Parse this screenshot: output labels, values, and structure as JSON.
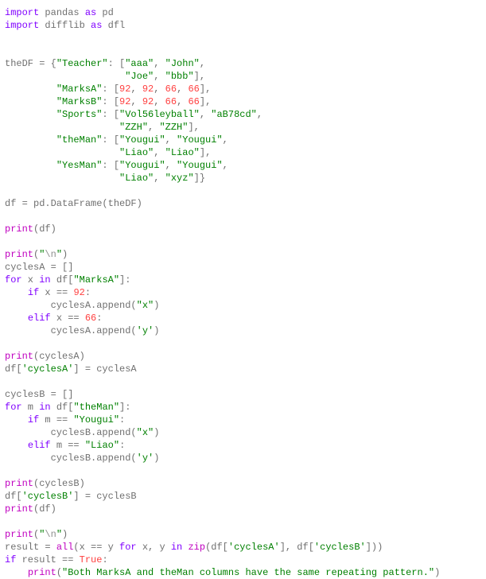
{
  "lines": [
    [
      {
        "cls": "kw",
        "t": "import"
      },
      {
        "cls": "",
        "t": " pandas "
      },
      {
        "cls": "kw",
        "t": "as"
      },
      {
        "cls": "",
        "t": " pd"
      }
    ],
    [
      {
        "cls": "kw",
        "t": "import"
      },
      {
        "cls": "",
        "t": " difflib "
      },
      {
        "cls": "kw",
        "t": "as"
      },
      {
        "cls": "",
        "t": " dfl"
      }
    ],
    [],
    [],
    [
      {
        "cls": "",
        "t": "theDF = {"
      },
      {
        "cls": "str",
        "t": "\"Teacher\""
      },
      {
        "cls": "",
        "t": ": ["
      },
      {
        "cls": "str",
        "t": "\"aaa\""
      },
      {
        "cls": "",
        "t": ", "
      },
      {
        "cls": "str",
        "t": "\"John\""
      },
      {
        "cls": "",
        "t": ","
      }
    ],
    [
      {
        "cls": "",
        "t": "                     "
      },
      {
        "cls": "str",
        "t": "\"Joe\""
      },
      {
        "cls": "",
        "t": ", "
      },
      {
        "cls": "str",
        "t": "\"bbb\""
      },
      {
        "cls": "",
        "t": "],"
      }
    ],
    [
      {
        "cls": "",
        "t": "         "
      },
      {
        "cls": "str",
        "t": "\"MarksA\""
      },
      {
        "cls": "",
        "t": ": ["
      },
      {
        "cls": "num",
        "t": "92"
      },
      {
        "cls": "",
        "t": ", "
      },
      {
        "cls": "num",
        "t": "92"
      },
      {
        "cls": "",
        "t": ", "
      },
      {
        "cls": "num",
        "t": "66"
      },
      {
        "cls": "",
        "t": ", "
      },
      {
        "cls": "num",
        "t": "66"
      },
      {
        "cls": "",
        "t": "],"
      }
    ],
    [
      {
        "cls": "",
        "t": "         "
      },
      {
        "cls": "str",
        "t": "\"MarksB\""
      },
      {
        "cls": "",
        "t": ": ["
      },
      {
        "cls": "num",
        "t": "92"
      },
      {
        "cls": "",
        "t": ", "
      },
      {
        "cls": "num",
        "t": "92"
      },
      {
        "cls": "",
        "t": ", "
      },
      {
        "cls": "num",
        "t": "66"
      },
      {
        "cls": "",
        "t": ", "
      },
      {
        "cls": "num",
        "t": "66"
      },
      {
        "cls": "",
        "t": "],"
      }
    ],
    [
      {
        "cls": "",
        "t": "         "
      },
      {
        "cls": "str",
        "t": "\"Sports\""
      },
      {
        "cls": "",
        "t": ": ["
      },
      {
        "cls": "str",
        "t": "\"Vol56leyball\""
      },
      {
        "cls": "",
        "t": ", "
      },
      {
        "cls": "str",
        "t": "\"aB78cd\""
      },
      {
        "cls": "",
        "t": ","
      }
    ],
    [
      {
        "cls": "",
        "t": "                    "
      },
      {
        "cls": "str",
        "t": "\"ZZH\""
      },
      {
        "cls": "",
        "t": ", "
      },
      {
        "cls": "str",
        "t": "\"ZZH\""
      },
      {
        "cls": "",
        "t": "],"
      }
    ],
    [
      {
        "cls": "",
        "t": "         "
      },
      {
        "cls": "str",
        "t": "\"theMan\""
      },
      {
        "cls": "",
        "t": ": ["
      },
      {
        "cls": "str",
        "t": "\"Yougui\""
      },
      {
        "cls": "",
        "t": ", "
      },
      {
        "cls": "str",
        "t": "\"Yougui\""
      },
      {
        "cls": "",
        "t": ","
      }
    ],
    [
      {
        "cls": "",
        "t": "                    "
      },
      {
        "cls": "str",
        "t": "\"Liao\""
      },
      {
        "cls": "",
        "t": ", "
      },
      {
        "cls": "str",
        "t": "\"Liao\""
      },
      {
        "cls": "",
        "t": "],"
      }
    ],
    [
      {
        "cls": "",
        "t": "         "
      },
      {
        "cls": "str",
        "t": "\"YesMan\""
      },
      {
        "cls": "",
        "t": ": ["
      },
      {
        "cls": "str",
        "t": "\"Yougui\""
      },
      {
        "cls": "",
        "t": ", "
      },
      {
        "cls": "str",
        "t": "\"Yougui\""
      },
      {
        "cls": "",
        "t": ","
      }
    ],
    [
      {
        "cls": "",
        "t": "                    "
      },
      {
        "cls": "str",
        "t": "\"Liao\""
      },
      {
        "cls": "",
        "t": ", "
      },
      {
        "cls": "str",
        "t": "\"xyz\""
      },
      {
        "cls": "",
        "t": "]}"
      }
    ],
    [],
    [
      {
        "cls": "",
        "t": "df = pd.DataFrame(theDF)"
      }
    ],
    [],
    [
      {
        "cls": "fn",
        "t": "print"
      },
      {
        "cls": "",
        "t": "(df)"
      }
    ],
    [],
    [
      {
        "cls": "fn",
        "t": "print"
      },
      {
        "cls": "",
        "t": "("
      },
      {
        "cls": "str",
        "t": "\""
      },
      {
        "cls": "esc",
        "t": "\\n"
      },
      {
        "cls": "str",
        "t": "\""
      },
      {
        "cls": "",
        "t": ")"
      }
    ],
    [
      {
        "cls": "",
        "t": "cyclesA = []"
      }
    ],
    [
      {
        "cls": "kw",
        "t": "for"
      },
      {
        "cls": "",
        "t": " x "
      },
      {
        "cls": "kw",
        "t": "in"
      },
      {
        "cls": "",
        "t": " df["
      },
      {
        "cls": "str",
        "t": "\"MarksA\""
      },
      {
        "cls": "",
        "t": "]:"
      }
    ],
    [
      {
        "cls": "",
        "t": "    "
      },
      {
        "cls": "kw",
        "t": "if"
      },
      {
        "cls": "",
        "t": " x == "
      },
      {
        "cls": "num",
        "t": "92"
      },
      {
        "cls": "",
        "t": ":"
      }
    ],
    [
      {
        "cls": "",
        "t": "        cyclesA.append("
      },
      {
        "cls": "str",
        "t": "\"x\""
      },
      {
        "cls": "",
        "t": ")"
      }
    ],
    [
      {
        "cls": "",
        "t": "    "
      },
      {
        "cls": "kw",
        "t": "elif"
      },
      {
        "cls": "",
        "t": " x == "
      },
      {
        "cls": "num",
        "t": "66"
      },
      {
        "cls": "",
        "t": ":"
      }
    ],
    [
      {
        "cls": "",
        "t": "        cyclesA.append("
      },
      {
        "cls": "str",
        "t": "'y'"
      },
      {
        "cls": "",
        "t": ")"
      }
    ],
    [],
    [
      {
        "cls": "fn",
        "t": "print"
      },
      {
        "cls": "",
        "t": "(cyclesA)"
      }
    ],
    [
      {
        "cls": "",
        "t": "df["
      },
      {
        "cls": "str",
        "t": "'cyclesA'"
      },
      {
        "cls": "",
        "t": "] = cyclesA"
      }
    ],
    [],
    [
      {
        "cls": "",
        "t": "cyclesB = []"
      }
    ],
    [
      {
        "cls": "kw",
        "t": "for"
      },
      {
        "cls": "",
        "t": " m "
      },
      {
        "cls": "kw",
        "t": "in"
      },
      {
        "cls": "",
        "t": " df["
      },
      {
        "cls": "str",
        "t": "\"theMan\""
      },
      {
        "cls": "",
        "t": "]:"
      }
    ],
    [
      {
        "cls": "",
        "t": "    "
      },
      {
        "cls": "kw",
        "t": "if"
      },
      {
        "cls": "",
        "t": " m == "
      },
      {
        "cls": "str",
        "t": "\"Yougui\""
      },
      {
        "cls": "",
        "t": ":"
      }
    ],
    [
      {
        "cls": "",
        "t": "        cyclesB.append("
      },
      {
        "cls": "str",
        "t": "\"x\""
      },
      {
        "cls": "",
        "t": ")"
      }
    ],
    [
      {
        "cls": "",
        "t": "    "
      },
      {
        "cls": "kw",
        "t": "elif"
      },
      {
        "cls": "",
        "t": " m == "
      },
      {
        "cls": "str",
        "t": "\"Liao\""
      },
      {
        "cls": "",
        "t": ":"
      }
    ],
    [
      {
        "cls": "",
        "t": "        cyclesB.append("
      },
      {
        "cls": "str",
        "t": "'y'"
      },
      {
        "cls": "",
        "t": ")"
      }
    ],
    [],
    [
      {
        "cls": "fn",
        "t": "print"
      },
      {
        "cls": "",
        "t": "(cyclesB)"
      }
    ],
    [
      {
        "cls": "",
        "t": "df["
      },
      {
        "cls": "str",
        "t": "'cyclesB'"
      },
      {
        "cls": "",
        "t": "] = cyclesB"
      }
    ],
    [
      {
        "cls": "fn",
        "t": "print"
      },
      {
        "cls": "",
        "t": "(df)"
      }
    ],
    [],
    [
      {
        "cls": "fn",
        "t": "print"
      },
      {
        "cls": "",
        "t": "("
      },
      {
        "cls": "str",
        "t": "\""
      },
      {
        "cls": "esc",
        "t": "\\n"
      },
      {
        "cls": "str",
        "t": "\""
      },
      {
        "cls": "",
        "t": ")"
      }
    ],
    [
      {
        "cls": "",
        "t": "result = "
      },
      {
        "cls": "fn",
        "t": "all"
      },
      {
        "cls": "",
        "t": "(x == y "
      },
      {
        "cls": "kw",
        "t": "for"
      },
      {
        "cls": "",
        "t": " x, y "
      },
      {
        "cls": "kw",
        "t": "in"
      },
      {
        "cls": "",
        "t": " "
      },
      {
        "cls": "fn",
        "t": "zip"
      },
      {
        "cls": "",
        "t": "(df["
      },
      {
        "cls": "str",
        "t": "'cyclesA'"
      },
      {
        "cls": "",
        "t": "], df["
      },
      {
        "cls": "str",
        "t": "'cyclesB'"
      },
      {
        "cls": "",
        "t": "]))"
      }
    ],
    [
      {
        "cls": "kw",
        "t": "if"
      },
      {
        "cls": "",
        "t": " result == "
      },
      {
        "cls": "num",
        "t": "True"
      },
      {
        "cls": "",
        "t": ":"
      }
    ],
    [
      {
        "cls": "",
        "t": "    "
      },
      {
        "cls": "fn",
        "t": "print"
      },
      {
        "cls": "",
        "t": "("
      },
      {
        "cls": "str",
        "t": "\"Both MarksA and theMan columns have the same repeating pattern.\""
      },
      {
        "cls": "",
        "t": ")"
      }
    ]
  ]
}
